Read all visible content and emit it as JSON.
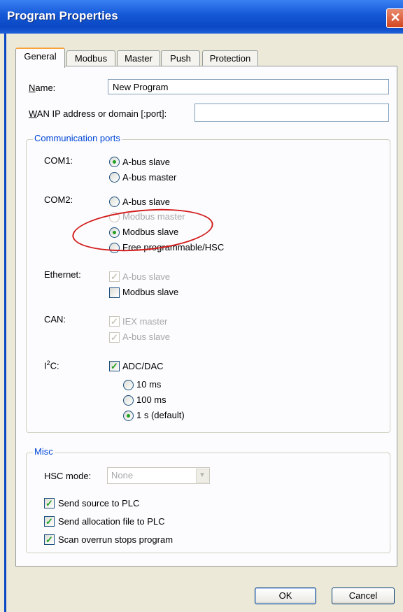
{
  "window": {
    "title": "Program Properties",
    "close_glyph": "✕"
  },
  "tabs": [
    {
      "label": "General",
      "active": true
    },
    {
      "label": "Modbus"
    },
    {
      "label": "Master"
    },
    {
      "label": "Push"
    },
    {
      "label": "Protection"
    }
  ],
  "general": {
    "name_label_u": "N",
    "name_label_rest": "ame:",
    "name_value": "New Program",
    "wan_label_u": "W",
    "wan_label_rest": "AN IP address or domain [:port]:",
    "wan_value": ""
  },
  "comm": {
    "legend": "Communication ports",
    "com1_label": "COM1:",
    "com1_opt1": "A-bus slave",
    "com1_opt2": "A-bus master",
    "com2_label": "COM2:",
    "com2_opt1": "A-bus slave",
    "com2_opt2": "Modbus master",
    "com2_opt3": "Modbus slave",
    "com2_opt4": "Free programmable/HSC",
    "eth_label": "Ethernet:",
    "eth_opt1": "A-bus slave",
    "eth_opt2": "Modbus slave",
    "can_label": "CAN:",
    "can_opt1": "IEX master",
    "can_opt2": "A-bus slave",
    "i2c_label_a": "I",
    "i2c_label_sup": "2",
    "i2c_label_b": "C:",
    "i2c_check": "ADC/DAC",
    "i2c_r1": "10 ms",
    "i2c_r2": "100 ms",
    "i2c_r3": "1 s (default)"
  },
  "misc": {
    "legend": "Misc",
    "hsc_label": "HSC mode:",
    "hsc_value": "None",
    "check1": "Send source to PLC",
    "check2": "Send allocation file to PLC",
    "check3": "Scan overrun stops program"
  },
  "buttons": {
    "ok": "OK",
    "cancel": "Cancel"
  },
  "colors": {
    "title_bar": "#0a48c4",
    "highlight_circle": "#d21c1c",
    "legend_text": "#0046d5",
    "check_mark": "#21a121"
  },
  "glyphs": {
    "check": "✓",
    "dropdown": "▼"
  }
}
